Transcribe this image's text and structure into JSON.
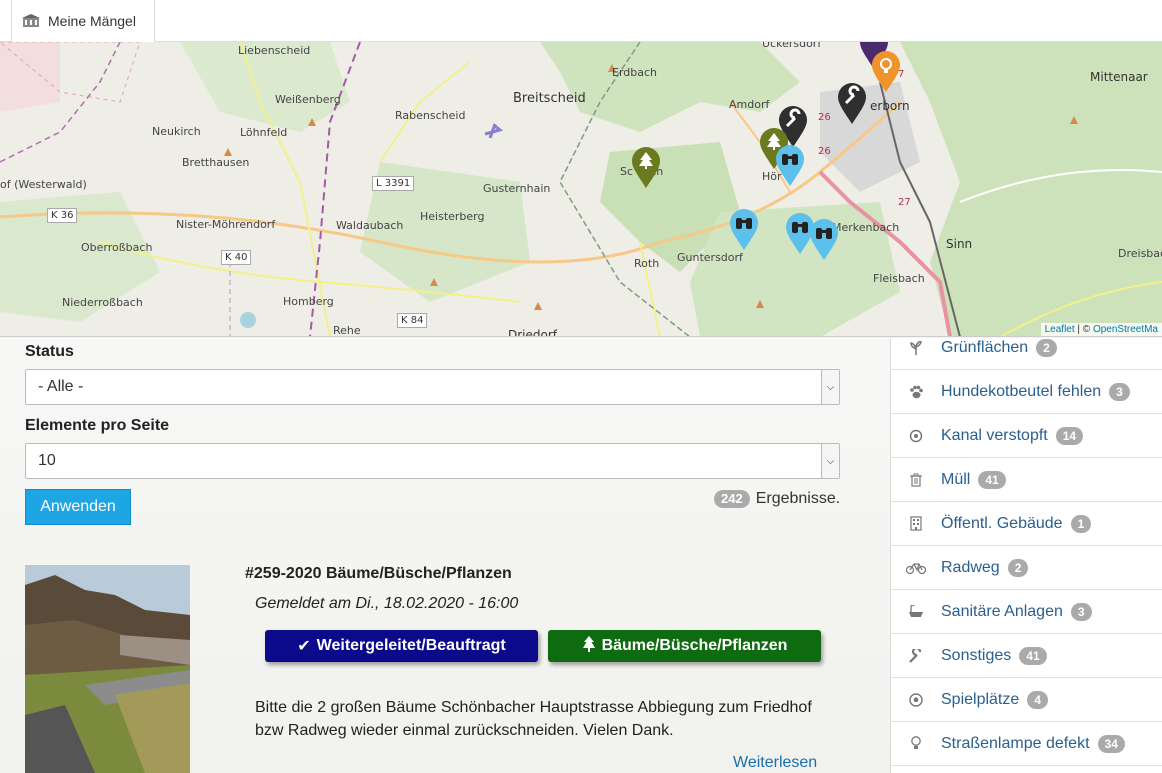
{
  "topbar": {
    "tab_label": "Meine Mängel"
  },
  "map": {
    "labels": {
      "liebenscheid": "Liebenscheid",
      "erdbach": "Erdbach",
      "uckersdorf": "Uckersdorf",
      "mittenaar": "Mittenaar",
      "weissenberg": "Weißenberg",
      "breitscheid": "Breitscheid",
      "amdorf": "Amdorf",
      "herborn": "erborn",
      "neukirch": "Neukirch",
      "loehnfeld": "Löhnfeld",
      "rabenscheid": "Rabenscheid",
      "bretthausen": "Bretthausen",
      "westerwald": "of (Westerwald)",
      "gusternhain": "Gusternhain",
      "schoenbach": "Sc     bach",
      "hoerbach": "Hör   h",
      "heisterberg": "Heisterberg",
      "waldaubach": "Waldaubach",
      "nister": "Nister-Möhrendorf",
      "merkenbach": "Merkenbach",
      "sinn": "Sinn",
      "dreisbach": "Dreisbach",
      "oberrossbach": "Oberroßbach",
      "roth": "Roth",
      "guntersdorf": "Guntersdorf",
      "fleisbach": "Fleisbach",
      "niederrossbach": "Niederroßbach",
      "homberg": "Homberg",
      "rehe": "Rehe",
      "driedorf": "Driedorf"
    },
    "roads": {
      "k36": "K 36",
      "k40": "K 40",
      "k84": "K 84",
      "l3391": "L 3391",
      "r26a": "26",
      "r26b": "26",
      "r27": "27",
      "r7": "7"
    },
    "attribution_leaflet": "Leaflet",
    "attribution_sep": " | © ",
    "attribution_osm": "OpenStreetMa"
  },
  "filters": {
    "status_label": "Status",
    "status_value": "- Alle -",
    "per_page_label": "Elemente pro Seite",
    "per_page_value": "10",
    "apply_label": "Anwenden",
    "results_count": "242",
    "results_label": "Ergebnisse."
  },
  "item": {
    "title": "#259-2020 Bäume/Büsche/Pflanzen",
    "date": "Gemeldet am Di., 18.02.2020 - 16:00",
    "status_tag": "Weitergeleitet/Beauftragt",
    "category_tag": "Bäume/Büsche/Pflanzen",
    "description": "Bitte die 2 großen Bäume Schönbacher Hauptstrasse Abbiegung zum Friedhof bzw Radweg wieder einmal zurückschneiden. Vielen Dank.",
    "read_more": "Weiterlesen"
  },
  "categories": [
    {
      "label": "Grünflächen",
      "count": "2",
      "icon": "plant-icon"
    },
    {
      "label": "Hundekotbeutel fehlen",
      "count": "3",
      "icon": "paw-icon"
    },
    {
      "label": "Kanal verstopft",
      "count": "14",
      "icon": "drain-icon"
    },
    {
      "label": "Müll",
      "count": "41",
      "icon": "trash-icon"
    },
    {
      "label": "Öffentl. Gebäude",
      "count": "1",
      "icon": "building-icon"
    },
    {
      "label": "Radweg",
      "count": "2",
      "icon": "bicycle-icon"
    },
    {
      "label": "Sanitäre Anlagen",
      "count": "3",
      "icon": "bathtub-icon"
    },
    {
      "label": "Sonstiges",
      "count": "41",
      "icon": "wrench-icon"
    },
    {
      "label": "Spielplätze",
      "count": "4",
      "icon": "ball-icon"
    },
    {
      "label": "Straßenlampe defekt",
      "count": "34",
      "icon": "lightbulb-icon"
    }
  ],
  "colors": {
    "accent": "#1ea5e3",
    "status_tag": "#0b0a8a",
    "category_tag": "#0f6b0f",
    "link": "#2a5f8e"
  }
}
